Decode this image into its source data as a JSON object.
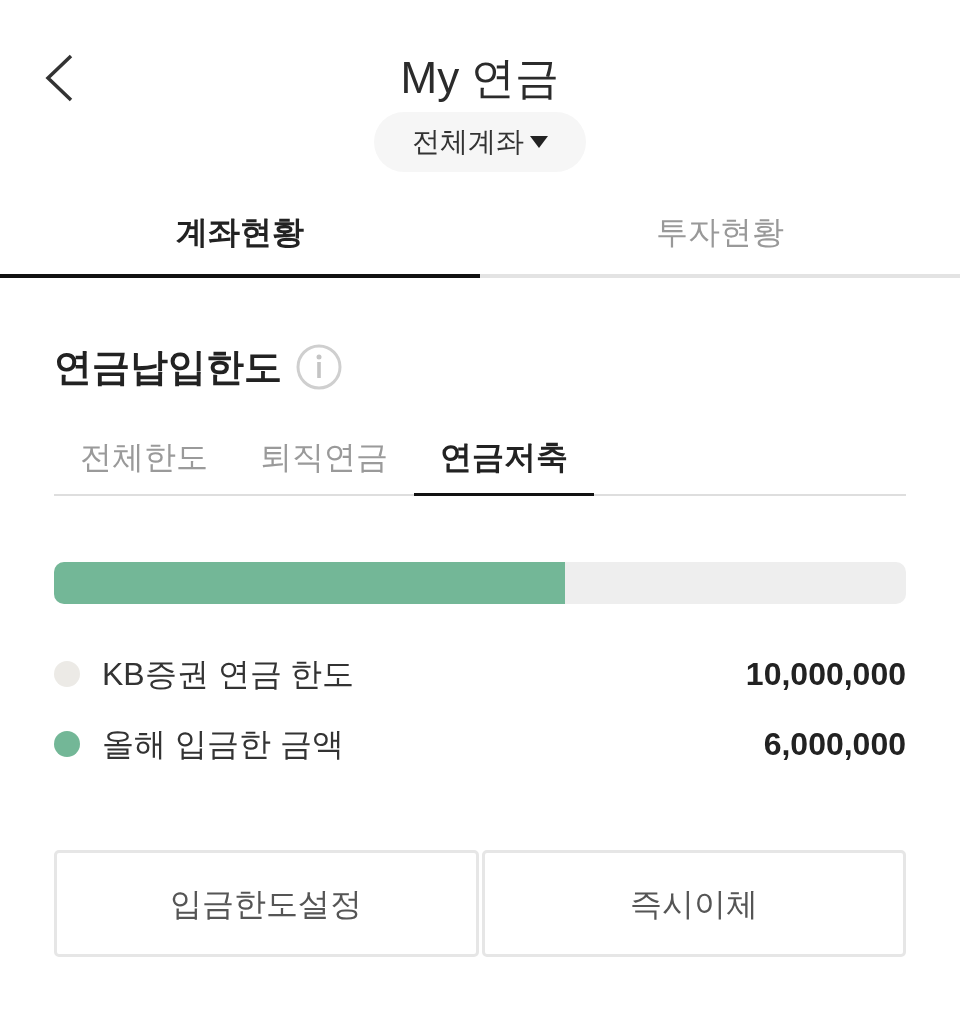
{
  "header": {
    "title": "My 연금",
    "account_selector": "전체계좌"
  },
  "tabs": [
    {
      "label": "계좌현황",
      "selected": true
    },
    {
      "label": "투자현황",
      "selected": false
    }
  ],
  "section": {
    "title": "연금납입한도",
    "sub_tabs": [
      {
        "label": "전체한도",
        "selected": false
      },
      {
        "label": "퇴직연금",
        "selected": false
      },
      {
        "label": "연금저축",
        "selected": true
      }
    ],
    "progress": {
      "level": 0.6
    },
    "legend": [
      {
        "label": "KB증권 연금 한도",
        "value": "10,000,000",
        "color": "#eceae6"
      },
      {
        "label": "올해 입금한 금액",
        "value": "6,000,000",
        "color": "#73b797"
      }
    ]
  },
  "buttons": [
    "입금한도설정",
    "즉시이체"
  ]
}
